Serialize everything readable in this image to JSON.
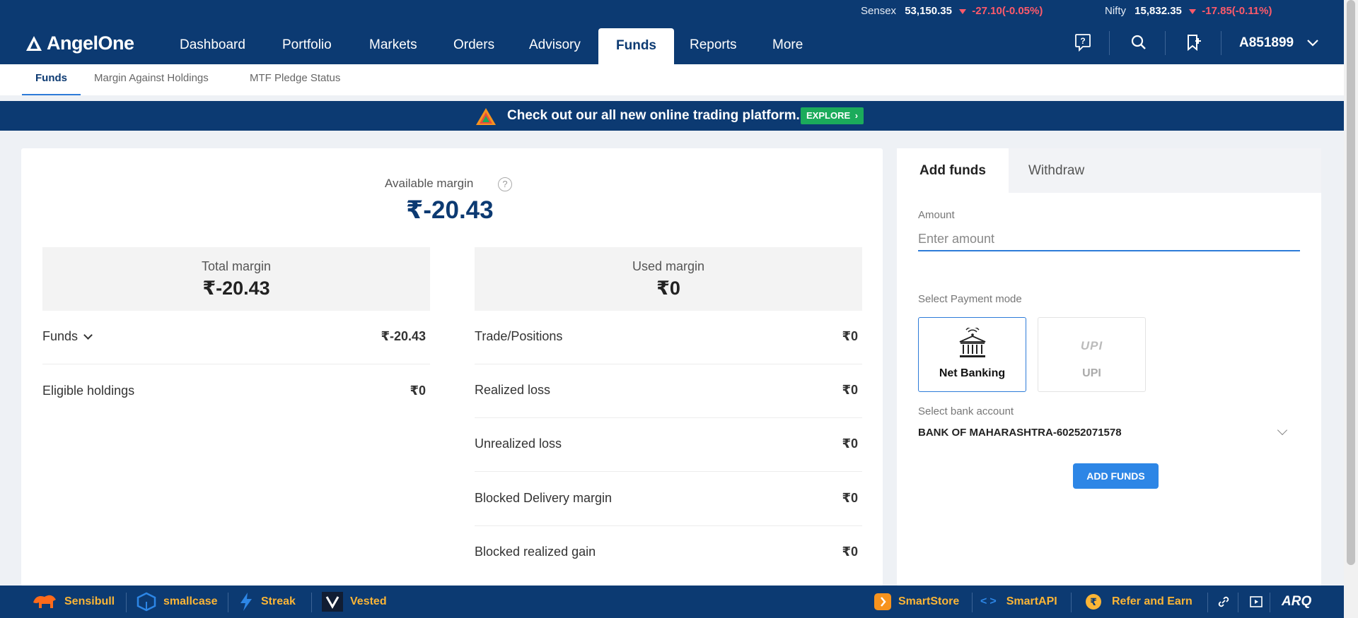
{
  "ticker": {
    "sensex": {
      "name": "Sensex",
      "value": "53,150.35",
      "change": "-27.10(-0.05%)"
    },
    "nifty": {
      "name": "Nifty",
      "value": "15,832.35",
      "change": "-17.85(-0.11%)"
    }
  },
  "brand": {
    "name": "AngelOne",
    "primary_color": "#0c3a72",
    "accent_color": "#2d86e6",
    "warning_color": "#fbb536"
  },
  "nav": {
    "items": [
      "Dashboard",
      "Portfolio",
      "Markets",
      "Orders",
      "Advisory",
      "Funds",
      "Reports",
      "More"
    ],
    "active": "Funds",
    "icons": [
      "help-chat-icon",
      "search-icon",
      "watchlist-add-icon"
    ],
    "account_id": "A851899"
  },
  "subtabs": {
    "items": [
      "Funds",
      "Margin Against Holdings",
      "MTF Pledge Status"
    ],
    "active": "Funds"
  },
  "banner": {
    "text": "Check out our all new online trading platform.",
    "button": "EXPLORE"
  },
  "margin": {
    "available_label": "Available margin",
    "available_value": "₹-20.43",
    "total_label": "Total margin",
    "total_value": "₹-20.43",
    "used_label": "Used margin",
    "used_value": "₹0",
    "left_rows": [
      {
        "label": "Funds",
        "value": "₹-20.43"
      },
      {
        "label": "Eligible holdings",
        "value": "₹0"
      }
    ],
    "right_rows": [
      {
        "label": "Trade/Positions",
        "value": "₹0"
      },
      {
        "label": "Realized loss",
        "value": "₹0"
      },
      {
        "label": "Unrealized loss",
        "value": "₹0"
      },
      {
        "label": "Blocked Delivery margin",
        "value": "₹0"
      },
      {
        "label": "Blocked realized gain",
        "value": "₹0"
      }
    ]
  },
  "add_funds": {
    "tabs": [
      "Add funds",
      "Withdraw"
    ],
    "active_tab": "Add funds",
    "amount_label": "Amount",
    "amount_placeholder": "Enter amount",
    "amount_value": "",
    "payment_label": "Select Payment mode",
    "payment_modes": [
      "Net Banking",
      "UPI"
    ],
    "payment_logo_text": "UPI",
    "selected_mode": "Net Banking",
    "bank_label": "Select bank account",
    "bank_value": "BANK OF MAHARASHTRA-60252071578",
    "submit": "ADD FUNDS"
  },
  "bottom_bar": {
    "left": [
      "Sensibull",
      "smallcase",
      "Streak",
      "Vested"
    ],
    "right": [
      "SmartStore",
      "SmartAPI",
      "Refer and Earn"
    ],
    "icons": [
      "link-icon",
      "video-icon"
    ],
    "powered_by": "ARQ"
  }
}
